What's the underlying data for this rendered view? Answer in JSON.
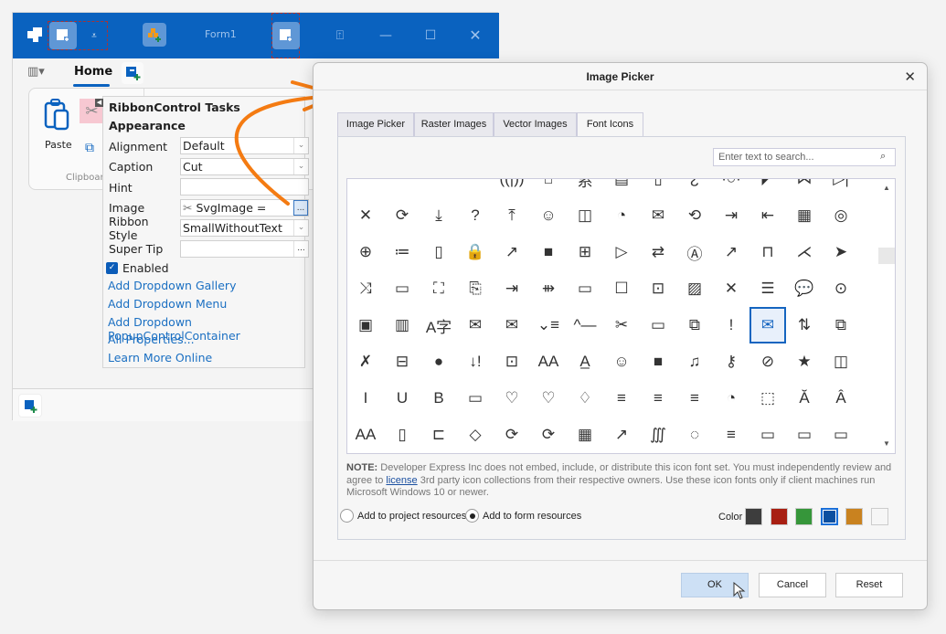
{
  "form": {
    "title": "Form1",
    "home_tab": "Home",
    "group_label": "Clipboard",
    "paste_label": "Paste"
  },
  "tasks": {
    "title": "RibbonControl Tasks",
    "section": "Appearance",
    "rows": [
      {
        "label": "Alignment",
        "value": "Default",
        "type": "dropdown"
      },
      {
        "label": "Caption",
        "value": "Cut",
        "type": "dropdown"
      },
      {
        "label": "Hint",
        "value": "",
        "type": "text"
      },
      {
        "label": "Image",
        "value": "SvgImage =",
        "type": "ellipsis"
      },
      {
        "label": "Ribbon Style",
        "value": "SmallWithoutText",
        "type": "dropdown"
      },
      {
        "label": "Super Tip",
        "value": "",
        "type": "ellipsis"
      }
    ],
    "enabled_label": "Enabled",
    "enabled": true,
    "links": [
      "Add Dropdown Gallery",
      "Add Dropdown Menu",
      "Add Dropdown PopupControlContainer",
      "All Properties...",
      "Learn More Online"
    ]
  },
  "dialog": {
    "title": "Image Picker",
    "tabs": [
      "Image Picker",
      "Raster Images",
      "Vector Images",
      "Font Icons"
    ],
    "active_tab": "Font Icons",
    "search_placeholder": "Enter text to search...",
    "icons": [
      "",
      "",
      "",
      "",
      "((|))",
      "⌂",
      "系",
      "▤",
      "▯",
      "¿",
      "·○·",
      "◤",
      "⋈",
      "▷|",
      "✕",
      "⟳",
      "⤓",
      "?",
      "⤒",
      "☺",
      "◫",
      "◔",
      "✉",
      "⟲",
      "⇥",
      "⇤",
      "▦",
      "◎",
      "⊕",
      "≔",
      "▯",
      "🔒",
      "↗",
      "■",
      "⊞",
      "▷",
      "⇄",
      "Ⓐ",
      "↗",
      "⊓",
      "⋌",
      "➤",
      "⤨",
      "▭",
      "⛶",
      "⎘",
      "⇥",
      "⇻",
      "▭",
      "☐",
      "⊡",
      "▨",
      "✕",
      "☰",
      "💬",
      "⊙",
      "▣",
      "▥",
      "A字",
      "✉",
      "✉",
      "⌄≡",
      "^—",
      "✂",
      "▭",
      "⧉",
      "!",
      "✉",
      "⇅",
      "⧉",
      "✗",
      "⊟",
      "●",
      "↓!",
      "⊡",
      "AA",
      "A̲",
      "☺",
      "■",
      "♫",
      "⚷",
      "⊘",
      "★",
      "◫",
      "I",
      "U",
      "B",
      "▭",
      "♡",
      "♡",
      "♢",
      "≡",
      "≡",
      "≡",
      "◔",
      "⬚",
      "Ă",
      "Â",
      "AA",
      "▯",
      "⊏",
      "◇",
      "⟳",
      "⟳",
      "▦",
      "↗",
      "∭",
      "◌",
      "≡",
      "▭",
      "▭",
      "▭"
    ],
    "selected_icon_index": 67,
    "note_bold": "NOTE:",
    "note_pre": " Developer Express Inc does not embed, include, or distribute this icon font set. You must independently review and agree to ",
    "note_link": "license",
    "note_post": " 3rd party icon collections from their respective owners. Use these icon fonts only if client machines run Microsoft Windows 10 or newer.",
    "radio_project": "Add to project resources",
    "radio_form": "Add to form resources",
    "radio_selected": "form",
    "color_label": "Color",
    "colors": [
      "#3d3d3d",
      "#a81f12",
      "#36963a",
      "#0b4fa0",
      "#c9821f",
      "#f6f6f6"
    ],
    "selected_color": "#0b4fa0",
    "ok": "OK",
    "cancel": "Cancel",
    "reset": "Reset"
  }
}
